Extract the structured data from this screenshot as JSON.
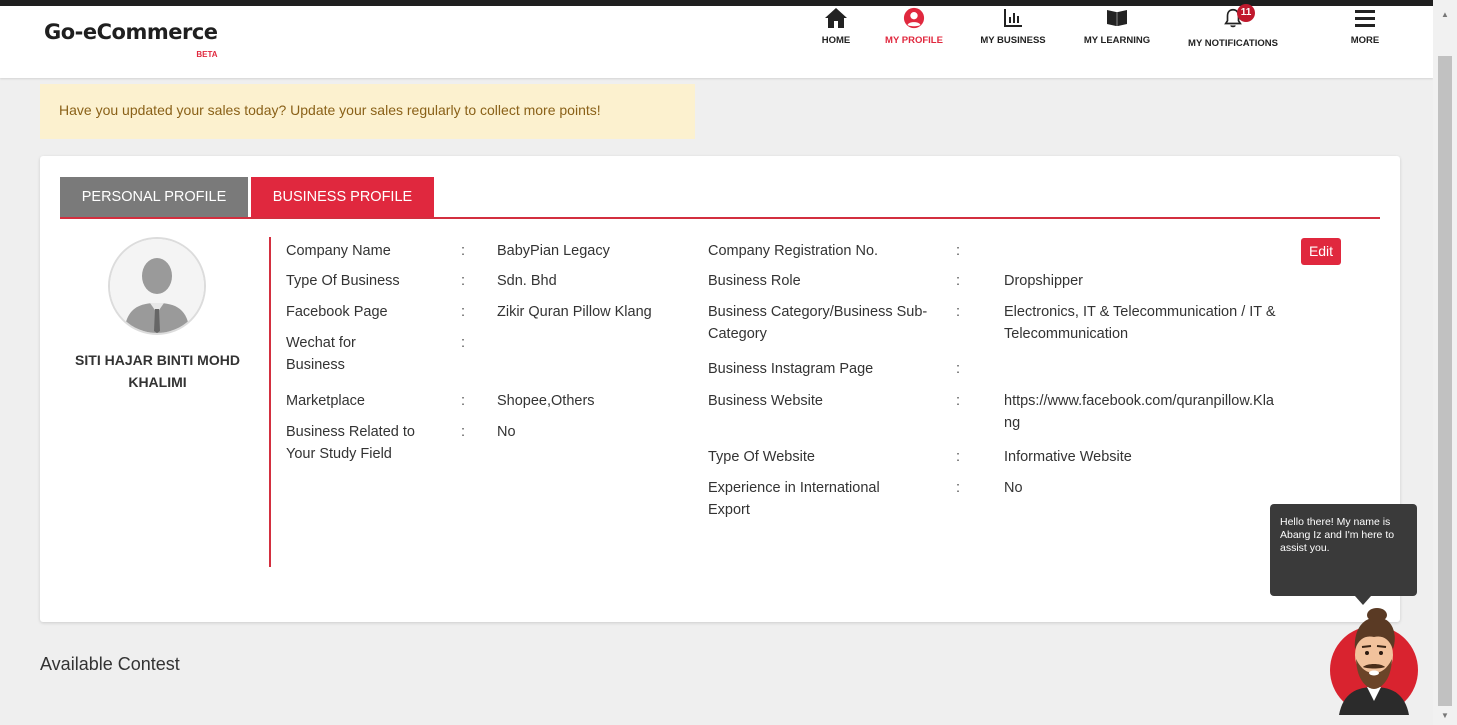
{
  "brand": {
    "name": "Go-eCommerce",
    "tag": "BETA"
  },
  "nav": [
    {
      "label": "HOME",
      "icon": "home-icon"
    },
    {
      "label": "MY PROFILE",
      "icon": "user-circle-icon",
      "active": true,
      "color": "#e0283e"
    },
    {
      "label": "MY BUSINESS",
      "icon": "bar-chart-icon"
    },
    {
      "label": "MY LEARNING",
      "icon": "open-book-icon"
    },
    {
      "label": "MY NOTIFICATIONS",
      "icon": "bell-icon",
      "badge": "11"
    },
    {
      "label": "MORE",
      "icon": "hamburger-menu-icon"
    }
  ],
  "notice": "Have you updated your sales today? Update your sales regularly to collect more points!",
  "tabs": {
    "personal": "PERSONAL PROFILE",
    "business": "BUSINESS PROFILE"
  },
  "user": {
    "name": "SITI HAJAR BINTI MOHD KHALIMI",
    "avatar_icon": "default-avatar-icon"
  },
  "left_fields": [
    {
      "label": "Company Name",
      "value": "BabyPian Legacy"
    },
    {
      "label": "Type Of Business",
      "value": "Sdn. Bhd"
    },
    {
      "label": "Facebook Page",
      "value": "Zikir Quran Pillow Klang"
    },
    {
      "label": "Wechat for Business",
      "value": ""
    },
    {
      "label": "Marketplace",
      "value": "Shopee,Others"
    },
    {
      "label": "Business Related to Your Study Field",
      "value": "No"
    }
  ],
  "right_fields": [
    {
      "label": "Company Registration No.",
      "value": ""
    },
    {
      "label": "Business Role",
      "value": "Dropshipper"
    },
    {
      "label": "Business Category/Business Sub-Category",
      "value": "Electronics, IT & Telecommunication / IT & Telecommunication"
    },
    {
      "label": "Business Instagram Page",
      "value": ""
    },
    {
      "label": "Business Website",
      "value": "https://www.facebook.com/quranpillow.Klang"
    },
    {
      "label": "Type Of Website",
      "value": "Informative Website"
    },
    {
      "label": "Experience in International Export",
      "value": "No"
    }
  ],
  "separator": ":",
  "edit_label": "Edit",
  "section_title": "Available Contest",
  "assistant": {
    "message": "Hello there! My name is Abang Iz and I'm here to assist you.",
    "icon": "assistant-avatar-icon"
  },
  "colors": {
    "accent": "#e0283e",
    "tab_inactive": "#7a7a7a",
    "notice_bg": "#fcf1cf",
    "notice_text": "#8a6118"
  }
}
